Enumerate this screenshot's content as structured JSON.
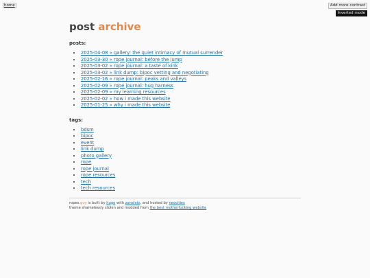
{
  "nav": {
    "home": "home",
    "contrast_button": "Add more contrast",
    "inverted_button": "Inverted mode"
  },
  "header": {
    "title_part1": "post",
    "title_part2": "archive"
  },
  "posts": {
    "heading": "posts:",
    "items": [
      "2025-04-08 » gallery: the quiet intimacy of mutual surrender",
      "2025-03-30 » rope journal: before the jump",
      "2025-03-02 » rope journal: a taste of kink",
      "2025-03-02 » link dump: bipoc vetting and negotiating",
      "2025-02-16 » rope journal: peaks and valleys",
      "2025-02-09 » rope journal: hug harness",
      "2025-02-09 » my learning resources",
      "2025-02-02 » how i made this website",
      "2025-01-25 » why i made this website"
    ]
  },
  "tags": {
    "heading": "tags:",
    "items": [
      "bdsm",
      "bipoc",
      "event",
      "link dump",
      "photo gallery",
      "rope",
      "rope journal",
      "rope resources",
      "tech",
      "tech resources"
    ]
  },
  "footer": {
    "site_prefix": "ropes.",
    "site_accent": "guy",
    "built_text": " is built by ",
    "hugo": "hugo",
    "with_text": " with ",
    "zonelets": "zonelets",
    "hosted_text": ", and hosted by ",
    "neocities": "neocities",
    "theme_text": "theme shamelessly stolen and modded from ",
    "theme_link": "the best motherfucking website"
  },
  "colors": {
    "accent": "#e1884c",
    "link": "#1a6fa5",
    "background": "#fafafa"
  }
}
